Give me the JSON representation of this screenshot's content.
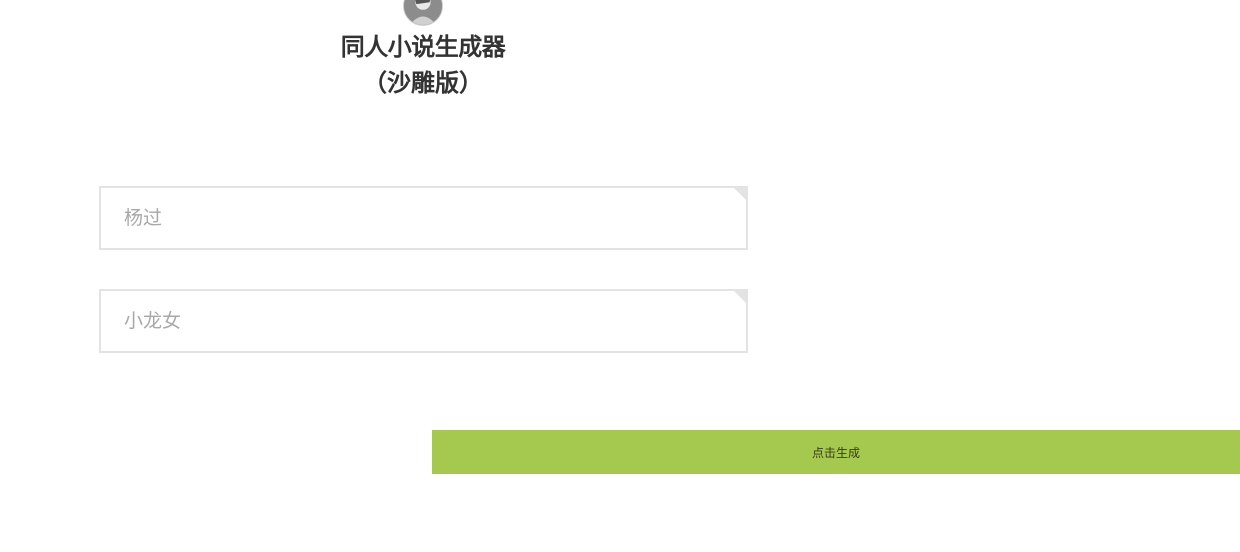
{
  "header": {
    "avatar_icon": "avatar-icon",
    "title": "同人小说生成器",
    "subtitle": "（沙雕版）"
  },
  "form": {
    "name1": {
      "value": "",
      "placeholder": "杨过"
    },
    "name2": {
      "value": "",
      "placeholder": "小龙女"
    },
    "submit_label": "点击生成"
  },
  "colors": {
    "accent": "#a5c94e",
    "field_border": "#e3e3e3",
    "placeholder_text": "#a8a8a8",
    "title_text": "#333333"
  }
}
